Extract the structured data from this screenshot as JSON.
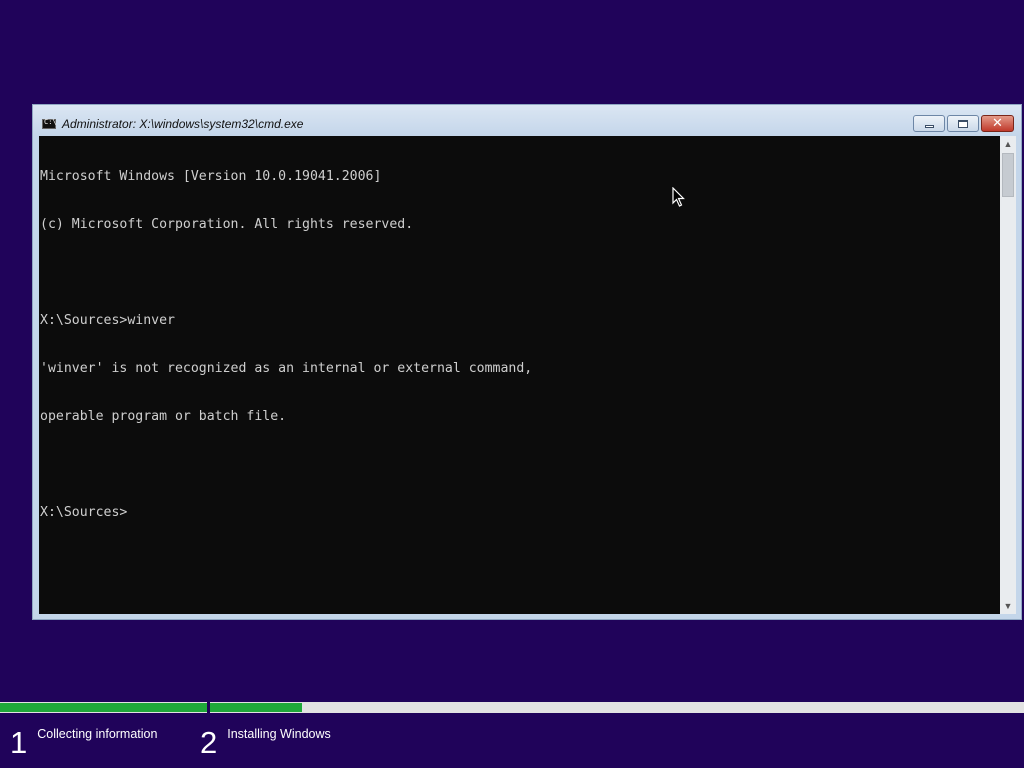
{
  "window": {
    "title": "Administrator: X:\\windows\\system32\\cmd.exe",
    "icon": "console-icon"
  },
  "console": {
    "lines": [
      "Microsoft Windows [Version 10.0.19041.2006]",
      "(c) Microsoft Corporation. All rights reserved.",
      "",
      "X:\\Sources>winver",
      "'winver' is not recognized as an internal or external command,",
      "operable program or batch file.",
      "",
      "X:\\Sources>"
    ]
  },
  "setup": {
    "steps": [
      {
        "number": "1",
        "label": "Collecting information"
      },
      {
        "number": "2",
        "label": "Installing Windows"
      }
    ],
    "progress": {
      "step1_fraction": 1.0,
      "step2_fraction": 0.11
    }
  },
  "colors": {
    "background": "#20035a",
    "console_bg": "#0c0c0c",
    "console_text": "#cfcfcf",
    "progress_fill": "#1fa83a",
    "close_button": "#c0392b"
  }
}
